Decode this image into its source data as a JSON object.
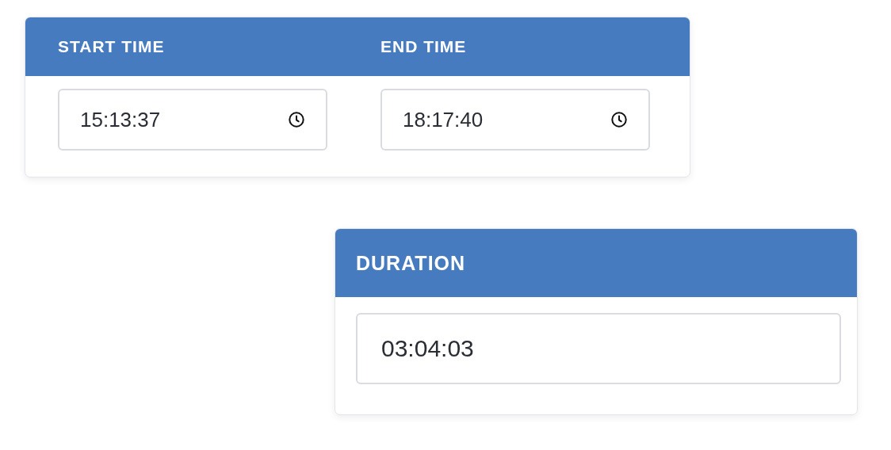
{
  "time_range": {
    "fields": [
      {
        "label": "START TIME",
        "value": "15:13:37",
        "kind": "clock"
      },
      {
        "label": "END TIME",
        "value": "18:17:40",
        "kind": "clock"
      }
    ]
  },
  "duration": {
    "label": "DURATION",
    "value": "03:04:03",
    "kind": "plain"
  }
}
